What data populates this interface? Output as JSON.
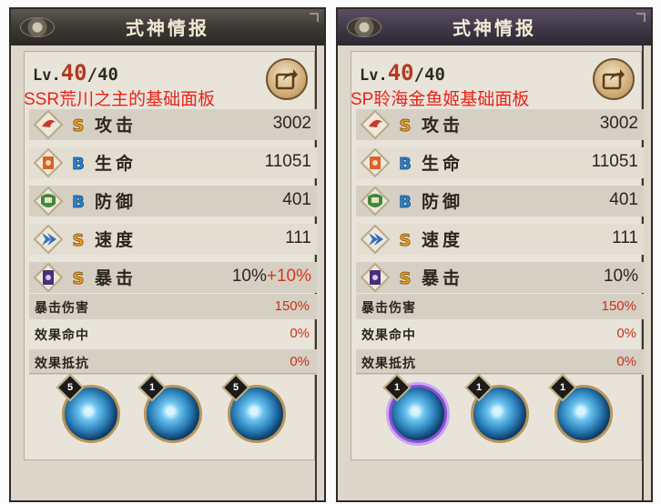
{
  "panels": [
    {
      "title": "式神情报",
      "level_label": "Lv.",
      "level_current": "40",
      "level_max": "/40",
      "note": "SSR荒川之主的基础面板",
      "stats": [
        {
          "label": "攻击",
          "grade": "S",
          "value": "3002",
          "bonus": "",
          "icon": "attack-icon"
        },
        {
          "label": "生命",
          "grade": "B",
          "value": "11051",
          "bonus": "",
          "icon": "health-icon"
        },
        {
          "label": "防御",
          "grade": "B",
          "value": "401",
          "bonus": "",
          "icon": "defense-icon"
        },
        {
          "label": "速度",
          "grade": "S",
          "value": "111",
          "bonus": "",
          "icon": "speed-icon"
        },
        {
          "label": "暴击",
          "grade": "S",
          "value": "10%",
          "bonus": "+10%",
          "icon": "crit-icon"
        }
      ],
      "sub_stats": [
        {
          "label": "暴击伤害",
          "value": "150%"
        },
        {
          "label": "效果命中",
          "value": "0%"
        },
        {
          "label": "效果抵抗",
          "value": "0%"
        }
      ],
      "skills": [
        {
          "level": "5",
          "icon": "skill-wave-icon"
        },
        {
          "level": "1",
          "icon": "skill-bird-icon"
        },
        {
          "level": "5",
          "icon": "skill-storm-icon"
        }
      ]
    },
    {
      "title": "式神情报",
      "level_label": "Lv.",
      "level_current": "40",
      "level_max": "/40",
      "note": "SP聆海金鱼姬基础面板",
      "stats": [
        {
          "label": "攻击",
          "grade": "S",
          "value": "3002",
          "bonus": "",
          "icon": "attack-icon"
        },
        {
          "label": "生命",
          "grade": "B",
          "value": "11051",
          "bonus": "",
          "icon": "health-icon"
        },
        {
          "label": "防御",
          "grade": "B",
          "value": "401",
          "bonus": "",
          "icon": "defense-icon"
        },
        {
          "label": "速度",
          "grade": "S",
          "value": "111",
          "bonus": "",
          "icon": "speed-icon"
        },
        {
          "label": "暴击",
          "grade": "S",
          "value": "10%",
          "bonus": "",
          "icon": "crit-icon"
        }
      ],
      "sub_stats": [
        {
          "label": "暴击伤害",
          "value": "150%"
        },
        {
          "label": "效果命中",
          "value": "0%"
        },
        {
          "label": "效果抵抗",
          "value": "0%"
        }
      ],
      "skills": [
        {
          "level": "1",
          "icon": "skill-fish-icon"
        },
        {
          "level": "1",
          "icon": "skill-figure-icon"
        },
        {
          "level": "1",
          "icon": "skill-splash-icon"
        }
      ]
    }
  ],
  "colors": {
    "grade_s": "#f0a020",
    "grade_b": "#2a86d6",
    "bonus": "#d33a1e",
    "note": "#e8231a"
  }
}
